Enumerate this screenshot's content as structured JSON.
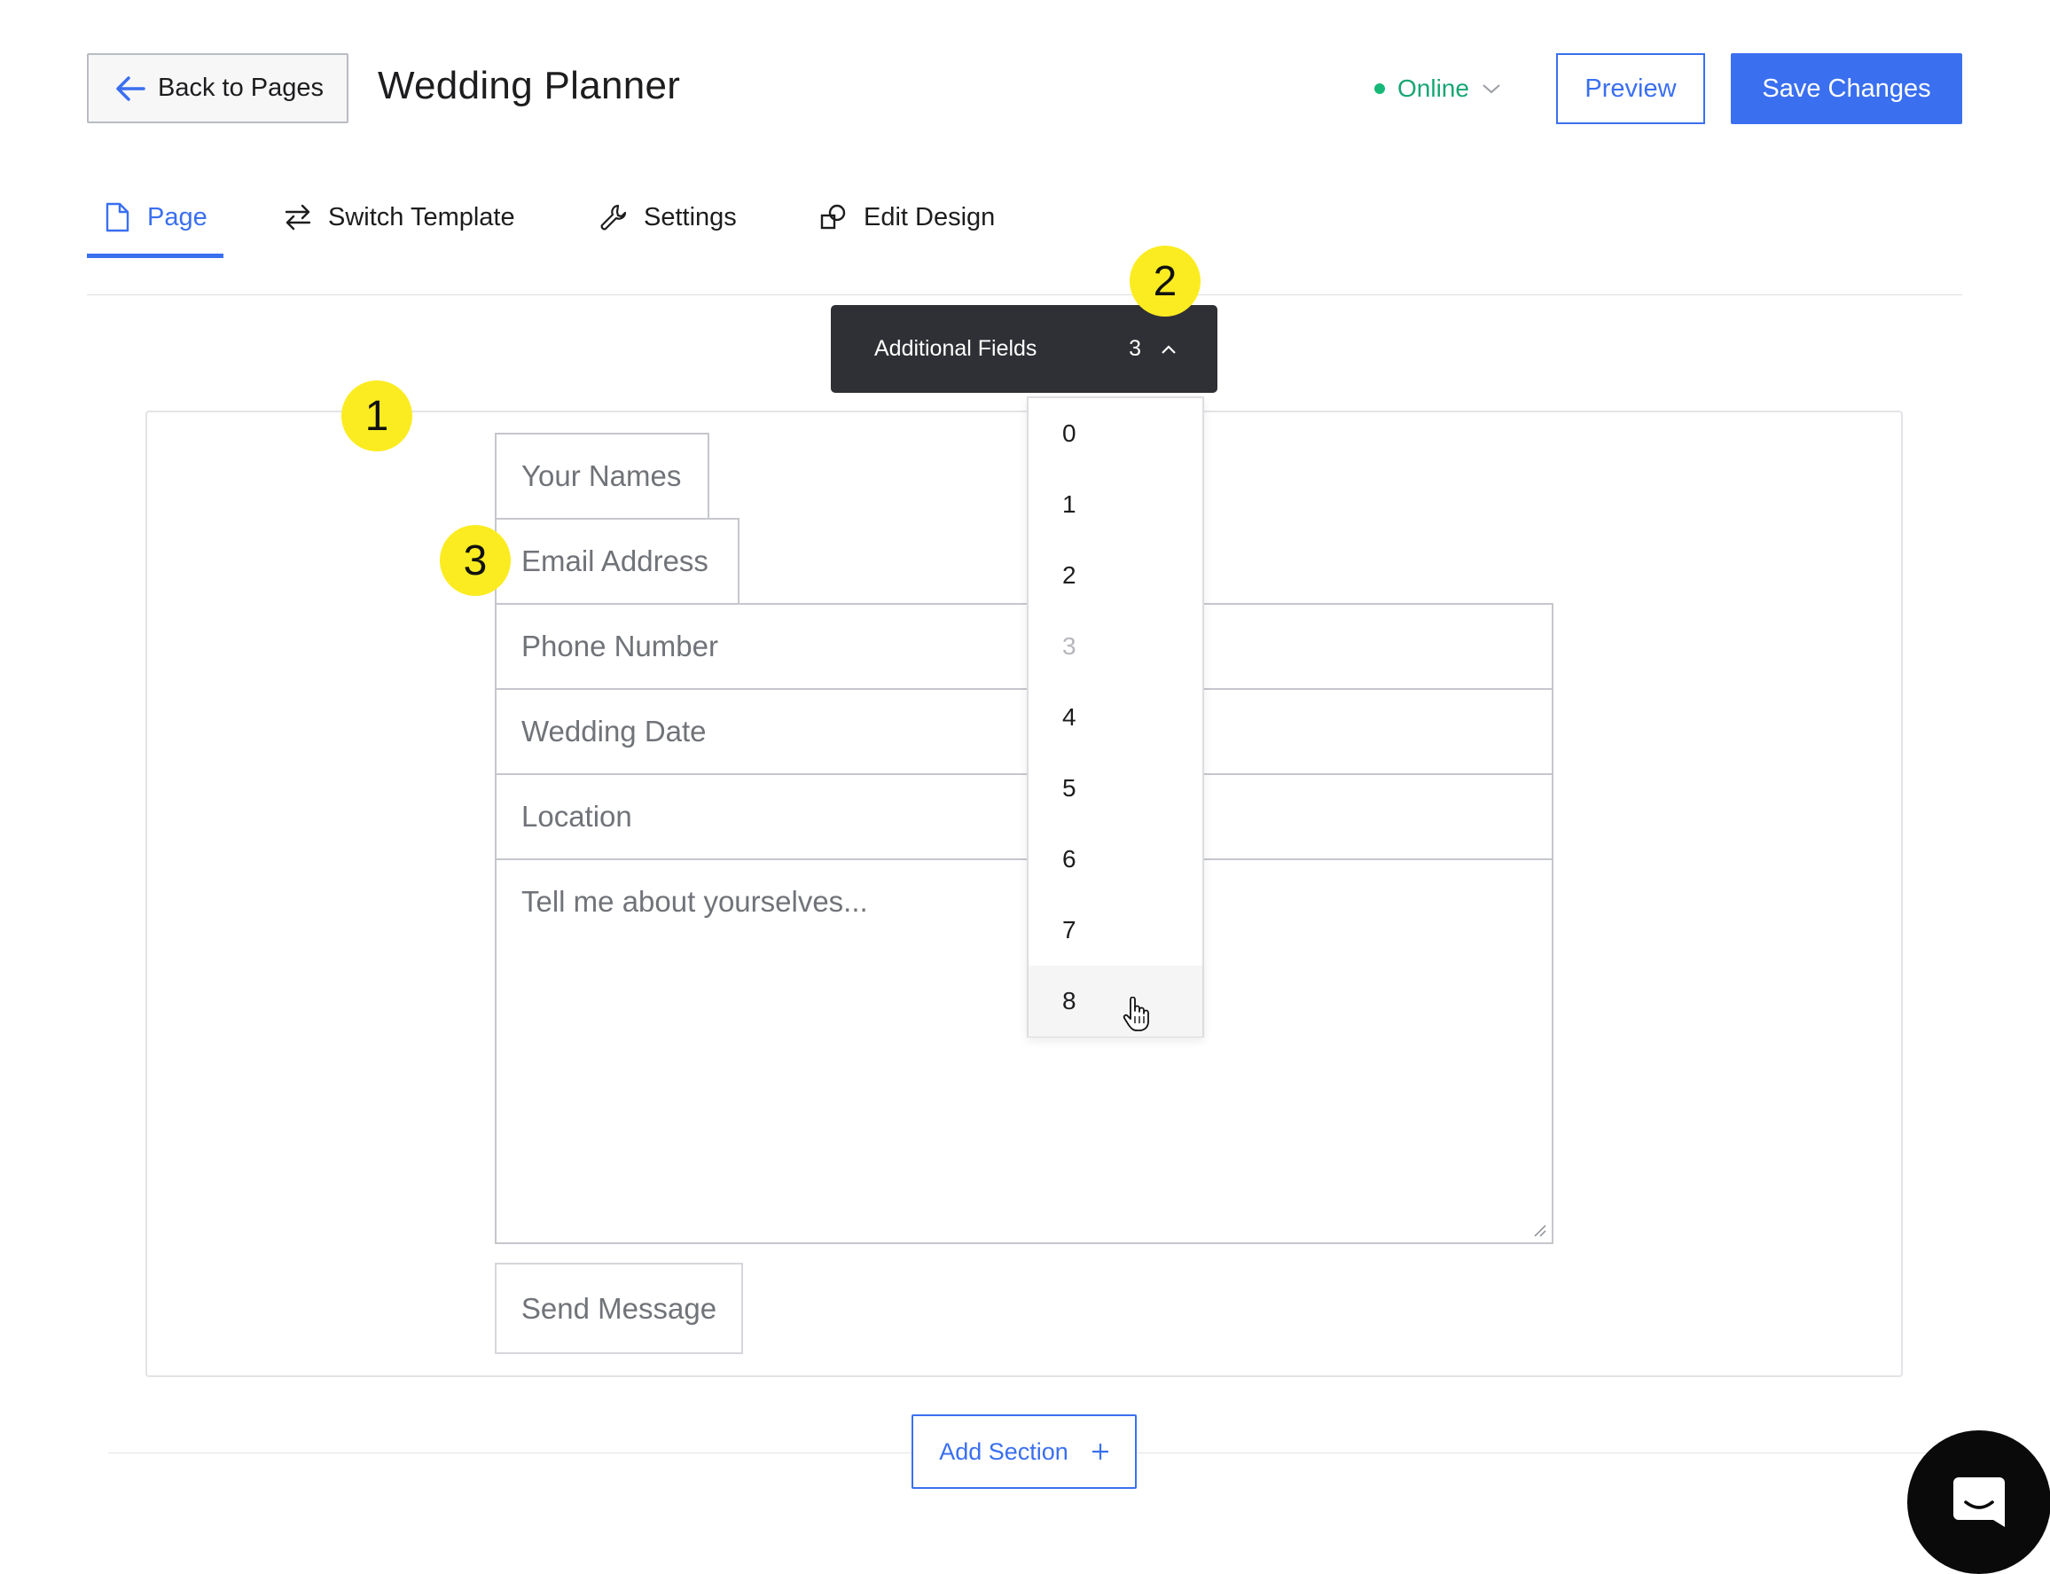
{
  "header": {
    "back_label": "Back to Pages",
    "title": "Wedding Planner",
    "status": "Online",
    "preview_label": "Preview",
    "save_label": "Save Changes"
  },
  "tabs": [
    {
      "label": "Page",
      "icon": "page-icon",
      "active": true
    },
    {
      "label": "Switch Template",
      "icon": "switch-arrows-icon",
      "active": false
    },
    {
      "label": "Settings",
      "icon": "wrench-icon",
      "active": false
    },
    {
      "label": "Edit Design",
      "icon": "shapes-icon",
      "active": false
    }
  ],
  "form": {
    "names_placeholder": "Your Names",
    "email_placeholder": "Email Address",
    "phone_placeholder": "Phone Number",
    "date_placeholder": "Wedding Date",
    "location_placeholder": "Location",
    "message_placeholder": "Tell me about yourselves...",
    "send_label": "Send Message"
  },
  "additional_fields": {
    "label": "Additional Fields",
    "value": "3",
    "options": [
      "0",
      "1",
      "2",
      "3",
      "4",
      "5",
      "6",
      "7",
      "8"
    ],
    "disabled_option": "3",
    "hovered_option": "8"
  },
  "badges": [
    "1",
    "2",
    "3"
  ],
  "footer": {
    "add_section_label": "Add Section"
  },
  "colors": {
    "accent": "#3a6ff0",
    "status_online": "#17b978",
    "callout": "#fbec21",
    "dropdown_bar": "#2f3035"
  }
}
